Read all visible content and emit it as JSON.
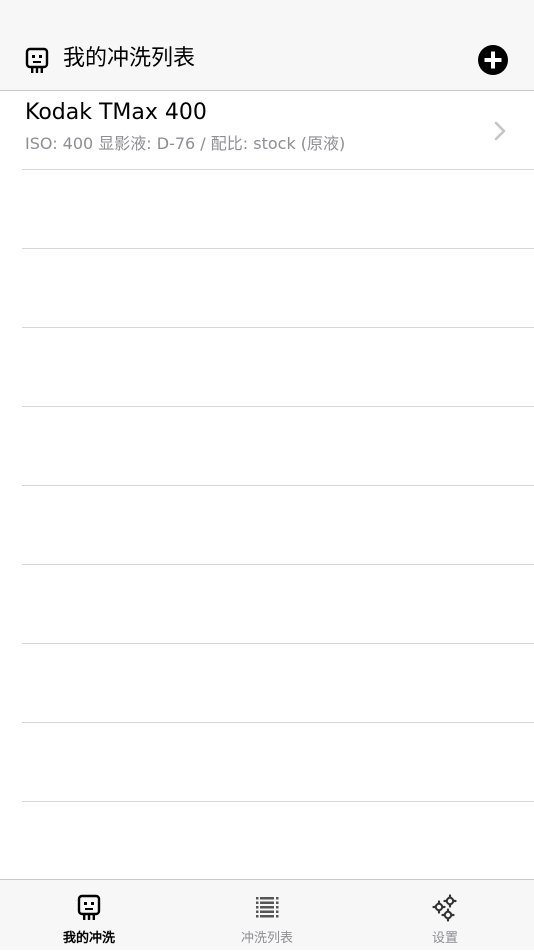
{
  "header": {
    "title": "我的冲洗列表",
    "left_icon": "robot-face-icon",
    "add_icon": "plus-circle-icon"
  },
  "list": {
    "items": [
      {
        "title": "Kodak TMax 400",
        "subtitle": "ISO: 400 显影液: D-76 / 配比: stock (原液)"
      }
    ],
    "empty_rows": 9
  },
  "tabbar": {
    "tabs": [
      {
        "label": "我的冲洗",
        "icon": "robot-face-icon",
        "active": true
      },
      {
        "label": "冲洗列表",
        "icon": "list-icon",
        "active": false
      },
      {
        "label": "设置",
        "icon": "gears-icon",
        "active": false
      }
    ]
  },
  "colors": {
    "header_bg": "#f7f7f7",
    "separator": "#d6d6d6",
    "subtitle": "#8e8e93",
    "active_tab": "#000000",
    "inactive_tab": "#8e8e93"
  }
}
